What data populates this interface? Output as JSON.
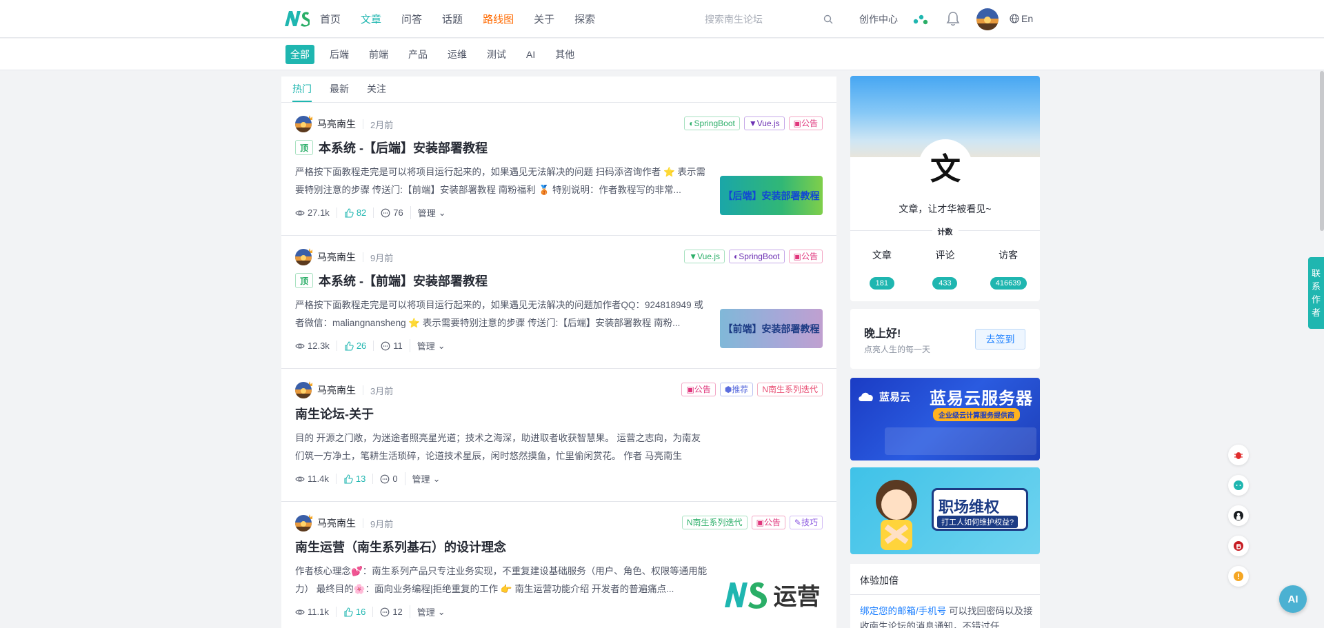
{
  "header": {
    "nav": [
      "首页",
      "文章",
      "问答",
      "话题",
      "路线图",
      "关于",
      "探索"
    ],
    "active_nav": "文章",
    "search_placeholder": "搜索南生论坛",
    "create_label": "创作中心",
    "lang_label": "En"
  },
  "subnav": {
    "items": [
      "全部",
      "后端",
      "前端",
      "产品",
      "运维",
      "测试",
      "AI",
      "其他"
    ],
    "active": "全部"
  },
  "tabs": [
    "热门",
    "最新",
    "关注"
  ],
  "articles": [
    {
      "author": "马亮南生",
      "time": "2月前",
      "pinned": true,
      "pin_label": "顶",
      "title": "本系统 -【后端】安装部署教程",
      "excerpt": "严格按下面教程走完是可以将项目运行起来的，如果遇见无法解决的问题 扫码添咨询作者 ⭐ 表示需要特别注意的步骤 传送门:【前端】安装部署教程 南粉福利 🥉 特别说明：作者教程写的非常...",
      "views": "27.1k",
      "likes": "82",
      "comments": "76",
      "manage": "管理",
      "tags": [
        {
          "icon": "◐",
          "label": "SpringBoot",
          "style": "t-green"
        },
        {
          "icon": "▼",
          "label": "Vue.js",
          "style": "t-vue"
        },
        {
          "icon": "▣",
          "label": "公告",
          "style": "t-notice"
        }
      ],
      "thumb_text": "【后端】安装部署教程",
      "thumb_style": "backend"
    },
    {
      "author": "马亮南生",
      "time": "9月前",
      "pinned": true,
      "pin_label": "顶",
      "title": "本系统 -【前端】安装部署教程",
      "excerpt": "严格按下面教程走完是可以将项目运行起来的，如果遇见无法解决的问题加作者QQ：924818949 或者微信：maliangnansheng ⭐ 表示需要特别注意的步骤 传送门:【后端】安装部署教程 南粉...",
      "views": "12.3k",
      "likes": "26",
      "comments": "11",
      "manage": "管理",
      "tags": [
        {
          "icon": "▼",
          "label": "Vue.js",
          "style": "t-green"
        },
        {
          "icon": "◐",
          "label": "SpringBoot",
          "style": "t-vue"
        },
        {
          "icon": "▣",
          "label": "公告",
          "style": "t-notice"
        }
      ],
      "thumb_text": "【前端】安装部署教程",
      "thumb_style": "frontend"
    },
    {
      "author": "马亮南生",
      "time": "3月前",
      "pinned": false,
      "title": "南生论坛-关于",
      "excerpt": "目的 开源之门敞，为迷途者照亮星光道；技术之海深，助进取者收获智慧果。 运营之志向，为南友们筑一方净土，笔耕生活琐碎，论道技术星辰，闲时悠然摸鱼，忙里偷闲赏花。 作者 马亮南生（maliangnansheng） 更新日志 ✔ 表示已经开源 ...",
      "views": "11.4k",
      "likes": "13",
      "comments": "0",
      "manage": "管理",
      "tags": [
        {
          "icon": "▣",
          "label": "公告",
          "style": "t-notice"
        },
        {
          "icon": "⬢",
          "label": "推荐",
          "style": "t-rec"
        },
        {
          "icon": "N",
          "label": "南生系列迭代",
          "style": "t-ns"
        }
      ],
      "thumb_text": "",
      "thumb_style": ""
    },
    {
      "author": "马亮南生",
      "time": "9月前",
      "pinned": false,
      "title": "南生运营（南生系列基石）的设计理念",
      "excerpt": "作者核心理念💕：南生系列产品只专注业务实现，不重复建设基础服务（用户、角色、权限等通用能力） 最终目的🌸：面向业务编程|拒绝重复的工作 👉 南生运营功能介绍 开发者的普遍痛点...",
      "views": "11.1k",
      "likes": "16",
      "comments": "12",
      "manage": "管理",
      "tags": [
        {
          "icon": "N",
          "label": "南生系列迭代",
          "style": "t-green"
        },
        {
          "icon": "▣",
          "label": "公告",
          "style": "t-notice"
        },
        {
          "icon": "✎",
          "label": "技巧",
          "style": "t-tip"
        }
      ],
      "thumb_text": "运营",
      "thumb_style": "ops"
    }
  ],
  "sidebar": {
    "emblem_char": "文",
    "motto": "文章，让才华被看见~",
    "count_title": "计数",
    "counts": [
      {
        "label": "文章",
        "value": "181"
      },
      {
        "label": "评论",
        "value": "433"
      },
      {
        "label": "访客",
        "value": "416639"
      }
    ],
    "greeting": "晚上好!",
    "greeting_sub": "点亮人生的每一天",
    "checkin_label": "去签到",
    "ad1_brand": "蓝易云",
    "ad1_title": "蓝易云服务器",
    "ad1_sub": "企业级云计算服务提供商",
    "ad2_title": "职场维权",
    "ad2_sub": "打工人如何维护权益?",
    "bonus_title": "体验加倍",
    "bonus_link": "绑定您的邮箱/手机号",
    "bonus_text": " 可以找回密码以及接收南生论坛的消息通知，不错过任"
  },
  "float": {
    "contact": [
      "联",
      "系",
      "作",
      "者"
    ],
    "ai_label": "AI"
  },
  "colors": {
    "accent": "#1fb6b0",
    "route": "#ff6a00",
    "link": "#1e80ff"
  }
}
